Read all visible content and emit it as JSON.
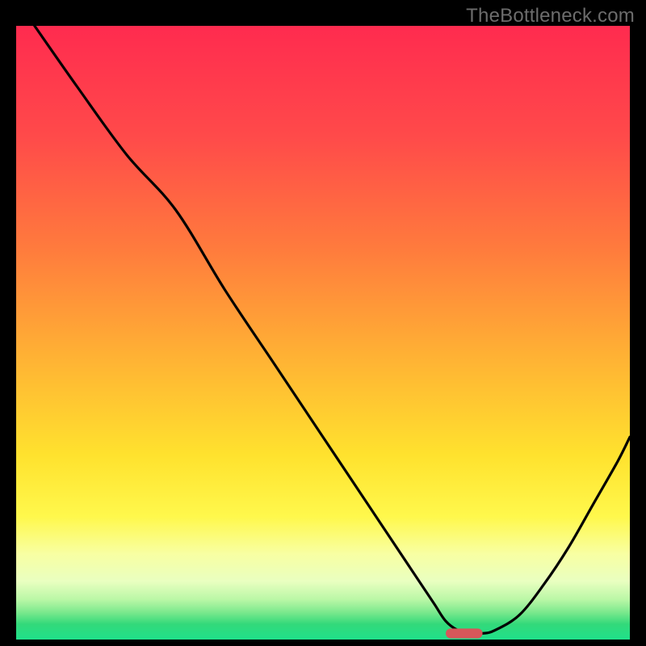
{
  "watermark": "TheBottleneck.com",
  "colors": {
    "frame": "#000000",
    "watermark": "#6c6c6c",
    "curve": "#000000",
    "marker_fill": "#d6575a",
    "gradient_stops": [
      {
        "offset": 0.0,
        "color": "#ff2b4f"
      },
      {
        "offset": 0.18,
        "color": "#ff4a4a"
      },
      {
        "offset": 0.36,
        "color": "#ff7a3d"
      },
      {
        "offset": 0.54,
        "color": "#ffb234"
      },
      {
        "offset": 0.7,
        "color": "#ffe22e"
      },
      {
        "offset": 0.8,
        "color": "#fff84c"
      },
      {
        "offset": 0.86,
        "color": "#f8ffa2"
      },
      {
        "offset": 0.905,
        "color": "#e9ffc0"
      },
      {
        "offset": 0.935,
        "color": "#baf7a6"
      },
      {
        "offset": 0.955,
        "color": "#7de98e"
      },
      {
        "offset": 0.975,
        "color": "#33d97a"
      },
      {
        "offset": 1.0,
        "color": "#1fe08a"
      }
    ]
  },
  "chart_data": {
    "type": "line",
    "title": "",
    "xlabel": "",
    "ylabel": "",
    "xlim": [
      0,
      100
    ],
    "ylim": [
      0,
      100
    ],
    "grid": false,
    "legend": null,
    "note": "Values are read in percent of plot area; (0,0) = bottom-left, (100,100) = top-right. Curve traces a V-shaped profile with an early slope break.",
    "series": [
      {
        "name": "curve",
        "x": [
          3,
          10,
          18,
          26,
          34,
          42,
          50,
          58,
          64,
          68,
          70,
          72,
          74,
          76,
          78,
          82,
          86,
          90,
          94,
          98,
          100
        ],
        "y": [
          100,
          90,
          79,
          70,
          57,
          45,
          33,
          21,
          12,
          6,
          3,
          1.5,
          1,
          1,
          1.5,
          4,
          9,
          15,
          22,
          29,
          33
        ]
      }
    ],
    "marker": {
      "note": "Rounded capsule at curve minimum on the baseline",
      "x_center": 73,
      "y_center": 1.0,
      "width": 6,
      "height": 1.6
    }
  }
}
